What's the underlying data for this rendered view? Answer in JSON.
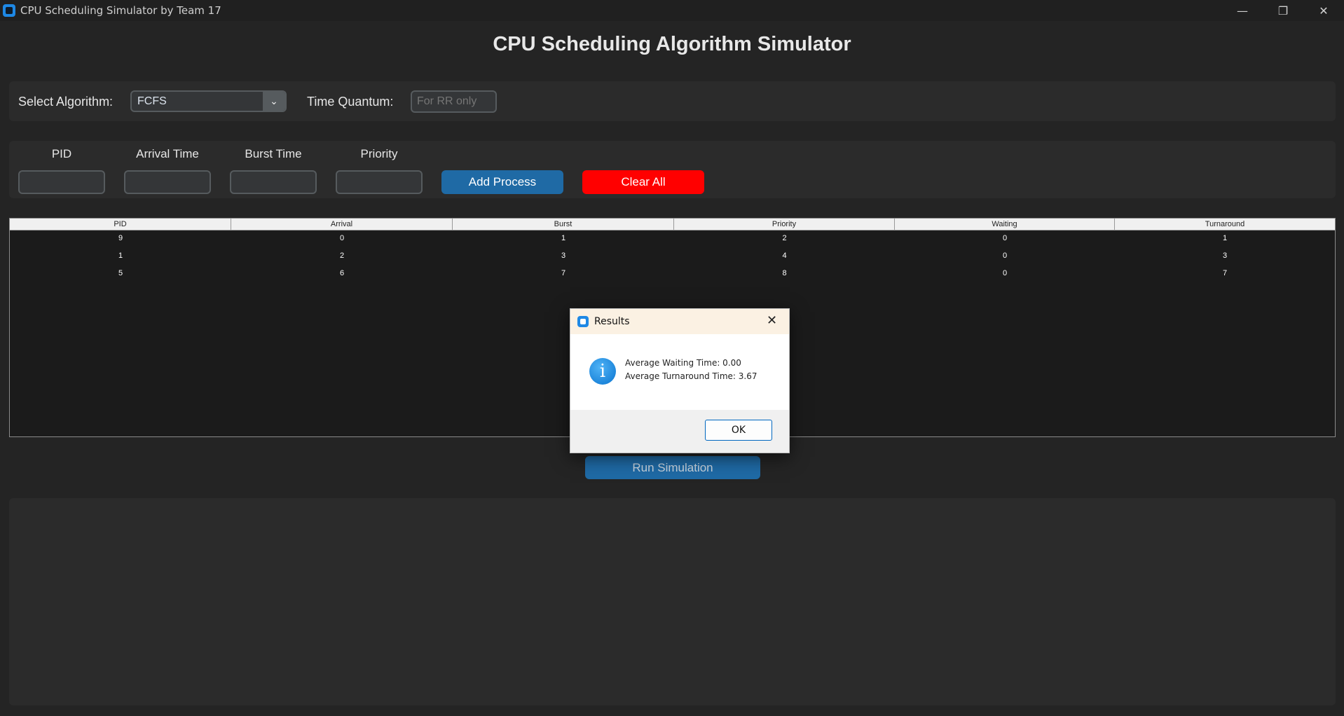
{
  "window": {
    "title": "CPU Scheduling Simulator by Team 17",
    "minimize_glyph": "—",
    "maximize_glyph": "❐",
    "close_glyph": "✕"
  },
  "header": {
    "title": "CPU Scheduling Algorithm Simulator"
  },
  "settings": {
    "algorithm_label": "Select Algorithm:",
    "algorithm_value": "FCFS",
    "quantum_label": "Time Quantum:",
    "quantum_placeholder": "For RR only"
  },
  "process_form": {
    "pid_label": "PID",
    "arrival_label": "Arrival Time",
    "burst_label": "Burst Time",
    "priority_label": "Priority",
    "add_button": "Add Process",
    "clear_button": "Clear All"
  },
  "table": {
    "columns": [
      "PID",
      "Arrival",
      "Burst",
      "Priority",
      "Waiting",
      "Turnaround"
    ],
    "rows": [
      [
        "9",
        "0",
        "1",
        "2",
        "0",
        "1"
      ],
      [
        "1",
        "2",
        "3",
        "4",
        "0",
        "3"
      ],
      [
        "5",
        "6",
        "7",
        "8",
        "0",
        "7"
      ]
    ]
  },
  "run_button": "Run Simulation",
  "dialog": {
    "title": "Results",
    "close_glyph": "✕",
    "info_glyph": "i",
    "line1": "Average Waiting Time: 0.00",
    "line2": "Average Turnaround Time: 3.67",
    "ok": "OK"
  },
  "colors": {
    "background": "#242424",
    "frame": "#2b2b2b",
    "accent_blue": "#1f6aa5",
    "danger_red": "#ff0000"
  },
  "icons": [
    "app-icon",
    "chevron-down-icon",
    "info-icon",
    "close-icon"
  ]
}
